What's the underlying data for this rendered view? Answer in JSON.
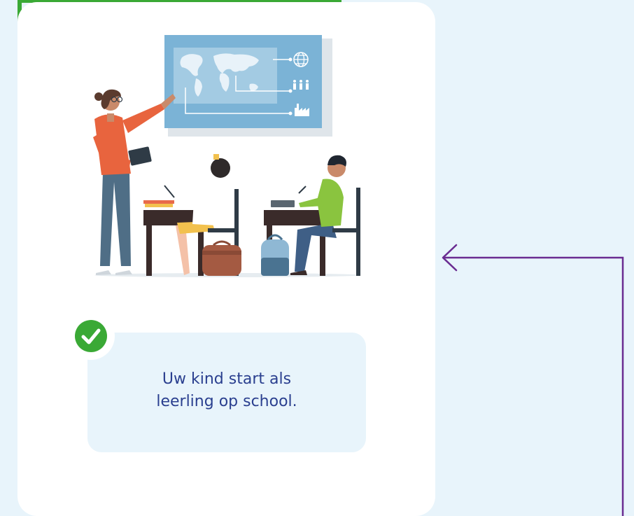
{
  "step": {
    "text_line1": "Uw kind start als",
    "text_line2": "leerling op school.",
    "status_icon": "check-circle-icon",
    "illustration": "classroom-illustration"
  },
  "colors": {
    "background": "#e8f4fb",
    "card": "#ffffff",
    "accent_green": "#3aa935",
    "text": "#2a3f8f",
    "connector": "#6a2c91"
  }
}
